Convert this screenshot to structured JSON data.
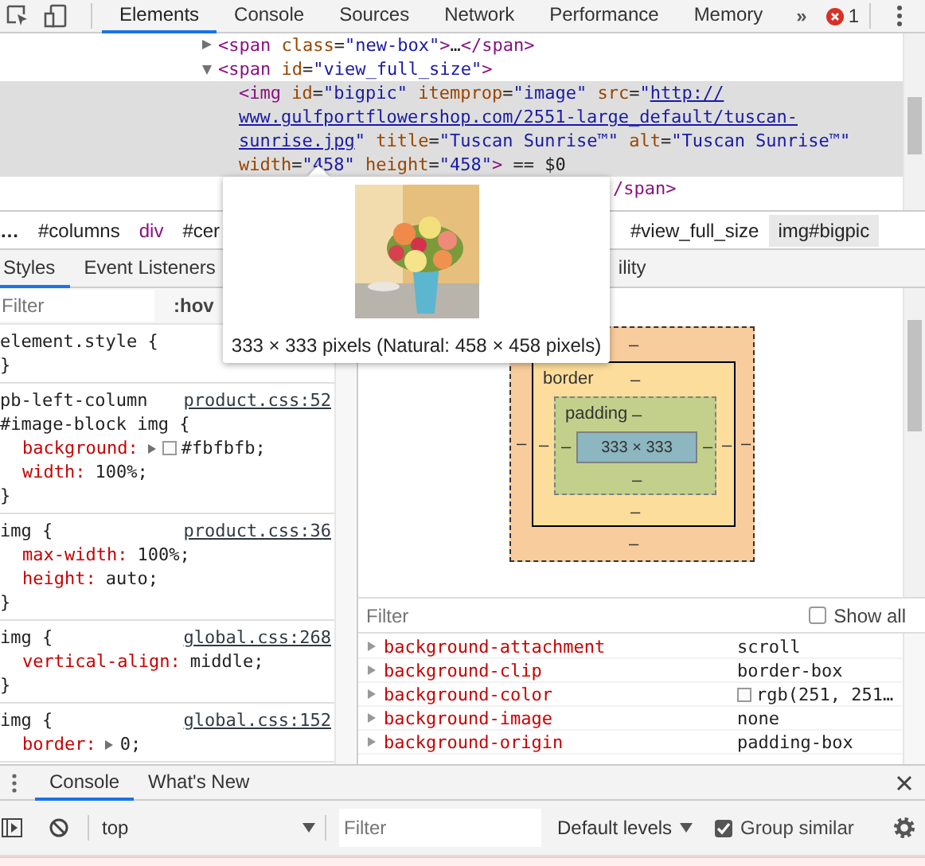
{
  "toolbar": {
    "tabs": [
      {
        "label": "Elements",
        "selected": true
      },
      {
        "label": "Console",
        "selected": false
      },
      {
        "label": "Sources",
        "selected": false
      },
      {
        "label": "Network",
        "selected": false
      },
      {
        "label": "Performance",
        "selected": false
      },
      {
        "label": "Memory",
        "selected": false
      }
    ],
    "more": "»",
    "error_count": "1"
  },
  "dom_tree": {
    "nodes": [
      {
        "selected": false,
        "expanded": false,
        "lines": [
          [
            {
              "t": "<span",
              "kind": "tag"
            },
            {
              "t": " class",
              "kind": "attr"
            },
            {
              "t": "=",
              "kind": "plain"
            },
            {
              "t": "\"new-box\"",
              "kind": "val"
            },
            {
              "t": ">",
              "kind": "tag"
            },
            {
              "t": "…",
              "kind": "plain"
            },
            {
              "t": "</span>",
              "kind": "tag"
            }
          ]
        ]
      },
      {
        "selected": false,
        "expanded": true,
        "lines": [
          [
            {
              "t": "<span",
              "kind": "tag"
            },
            {
              "t": " id",
              "kind": "attr"
            },
            {
              "t": "=",
              "kind": "plain"
            },
            {
              "t": "\"view_full_size\"",
              "kind": "val"
            },
            {
              "t": ">",
              "kind": "tag"
            }
          ]
        ],
        "children": [
          {
            "selected": true,
            "lines": [
              [
                {
                  "t": "<img",
                  "kind": "tag"
                },
                {
                  "t": " id",
                  "kind": "attr"
                },
                {
                  "t": "=",
                  "kind": "plain"
                },
                {
                  "t": "\"bigpic\"",
                  "kind": "val"
                },
                {
                  "t": " itemprop",
                  "kind": "attr"
                },
                {
                  "t": "=",
                  "kind": "plain"
                },
                {
                  "t": "\"image\"",
                  "kind": "val"
                },
                {
                  "t": " src",
                  "kind": "attr"
                },
                {
                  "t": "=",
                  "kind": "plain"
                },
                {
                  "t": "\"",
                  "kind": "val"
                },
                {
                  "t": "http://",
                  "kind": "link"
                }
              ],
              [
                {
                  "t": "www.gulfportflowershop.com/2551-large_default/tuscan-",
                  "kind": "link"
                }
              ],
              [
                {
                  "t": "sunrise.jpg",
                  "kind": "link"
                },
                {
                  "t": "\"",
                  "kind": "val"
                },
                {
                  "t": " title",
                  "kind": "attr"
                },
                {
                  "t": "=",
                  "kind": "plain"
                },
                {
                  "t": "\"Tuscan Sunrise™\"",
                  "kind": "val"
                },
                {
                  "t": " alt",
                  "kind": "attr"
                },
                {
                  "t": "=",
                  "kind": "plain"
                },
                {
                  "t": "\"Tuscan Sunrise™\"",
                  "kind": "val"
                }
              ],
              [
                {
                  "t": "width",
                  "kind": "attr"
                },
                {
                  "t": "=",
                  "kind": "plain"
                },
                {
                  "t": "\"458\"",
                  "kind": "val"
                },
                {
                  "t": " height",
                  "kind": "attr"
                },
                {
                  "t": "=",
                  "kind": "plain"
                },
                {
                  "t": "\"458\"",
                  "kind": "val"
                },
                {
                  "t": ">",
                  "kind": "tag"
                },
                {
                  "t": " == $0",
                  "kind": "plain"
                }
              ]
            ]
          },
          {
            "selected": false,
            "occluded": true,
            "lines": [
              [
                {
                  "t": "/span>",
                  "kind": "tag"
                }
              ]
            ]
          }
        ]
      }
    ]
  },
  "breadcrumbs": {
    "leading": [
      {
        "label": "…",
        "kind": "ellipsis",
        "selected": false
      },
      {
        "label": "#columns",
        "kind": "id",
        "selected": false
      },
      {
        "label": "div",
        "kind": "tag",
        "selected": false
      },
      {
        "label": "#cer",
        "kind": "id",
        "selected": false
      }
    ],
    "trailing": [
      {
        "label": "#view_full_size",
        "kind": "id",
        "selected": false
      },
      {
        "label": "img#bigpic",
        "kind": "id",
        "selected": true
      }
    ]
  },
  "image_tooltip": {
    "caption": "333 × 333 pixels (Natural: 458 × 458 pixels)"
  },
  "sidebar_tabs": {
    "leading": [
      {
        "label": "Styles",
        "selected": true
      },
      {
        "label": "Event Listeners",
        "selected": false
      }
    ],
    "trailing": [
      {
        "label": "ility",
        "selected": false
      }
    ]
  },
  "styles": {
    "filter": {
      "placeholder": "Filter"
    },
    "hov": ":hov",
    "rules": [
      {
        "selectors": [
          "element.style {"
        ],
        "closing": "}"
      },
      {
        "selectors": [
          "pb-left-column",
          "#image-block img {"
        ],
        "source": "product.css:52",
        "properties": [
          {
            "name": "background:",
            "value": "#fbfbfb;",
            "expandable": true,
            "color": "#fbfbfb"
          },
          {
            "name": "width:",
            "value": "100%;",
            "expandable": false
          }
        ],
        "closing": "}"
      },
      {
        "selectors": [
          "img {"
        ],
        "source": "product.css:36",
        "properties": [
          {
            "name": "max-width:",
            "value": "100%;",
            "expandable": false
          },
          {
            "name": "height:",
            "value": "auto;",
            "expandable": false
          }
        ],
        "closing": "}"
      },
      {
        "selectors": [
          "img {"
        ],
        "source": "global.css:268",
        "properties": [
          {
            "name": "vertical-align:",
            "value": "middle;",
            "expandable": false
          }
        ],
        "closing": "}"
      },
      {
        "selectors": [
          "img {"
        ],
        "source": "global.css:152",
        "properties": [
          {
            "name": "border:",
            "value": "0;",
            "expandable": true
          }
        ]
      }
    ]
  },
  "box_model": {
    "margin": {
      "top": "–",
      "right": "–",
      "bottom": "–",
      "left": "–"
    },
    "border": {
      "label": "border",
      "top": "–",
      "right": "–",
      "bottom": "–",
      "left": "–"
    },
    "padding": {
      "label": "padding",
      "top": "–",
      "right": "–",
      "bottom": "–",
      "left": "–"
    },
    "content": "333 × 333"
  },
  "computed": {
    "filter": {
      "placeholder": "Filter"
    },
    "show_all": {
      "label": "Show all",
      "checked": false
    },
    "properties": [
      {
        "name": "background-attachment",
        "value": "scroll"
      },
      {
        "name": "background-clip",
        "value": "border-box"
      },
      {
        "name": "background-color",
        "value": "rgb(251, 251…",
        "color": "#fbfbfb"
      },
      {
        "name": "background-image",
        "value": "none"
      },
      {
        "name": "background-origin",
        "value": "padding-box"
      }
    ]
  },
  "drawer": {
    "tabs": [
      {
        "label": "Console",
        "selected": true
      },
      {
        "label": "What's New",
        "selected": false
      }
    ],
    "context": "top",
    "filter": {
      "placeholder": "Filter"
    },
    "levels": "Default levels",
    "group_similar": {
      "label": "Group similar",
      "checked": true
    }
  }
}
